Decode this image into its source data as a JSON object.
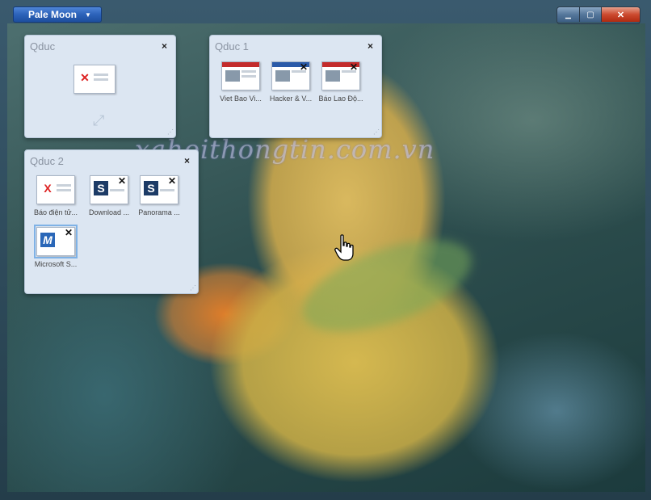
{
  "app_button": {
    "label": "Pale Moon",
    "caret": "▼"
  },
  "window_controls": {
    "minimize": "▁",
    "maximize": "▢",
    "close": "✕"
  },
  "watermark": "xahoithongtin.com.vn",
  "groups": [
    {
      "title": "Qduc",
      "close_label": "×",
      "resize_label": "⋰",
      "expand_icon": "⤢",
      "tabs": [
        {
          "label": "",
          "thumb": "news-red"
        }
      ]
    },
    {
      "title": "Qduc 1",
      "close_label": "×",
      "resize_label": "⋰",
      "tabs": [
        {
          "label": "Viet Bao Vi...",
          "thumb": "news-red"
        },
        {
          "label": "Hacker & V...",
          "thumb": "news-blue"
        },
        {
          "label": "Báo Lao Độ...",
          "thumb": "news-red"
        }
      ]
    },
    {
      "title": "Qduc 2",
      "close_label": "×",
      "resize_label": "⋰",
      "tabs": [
        {
          "label": "Báo điện tử...",
          "thumb": "logo-x",
          "logo": "X"
        },
        {
          "label": "Download ...",
          "thumb": "logo-s",
          "logo": "S"
        },
        {
          "label": "Panorama ...",
          "thumb": "logo-s",
          "logo": "S"
        },
        {
          "label": "Microsoft S...",
          "thumb": "logo-m",
          "logo": "M"
        }
      ]
    }
  ],
  "colors": {
    "group_bg": "#dce6f2",
    "app_button": "#2c62b9",
    "close_button": "#cc4a2f"
  },
  "icons": [
    "close-icon",
    "minimize-icon",
    "maximize-icon",
    "expand-icon",
    "hand-cursor-icon",
    "caret-down-icon"
  ]
}
